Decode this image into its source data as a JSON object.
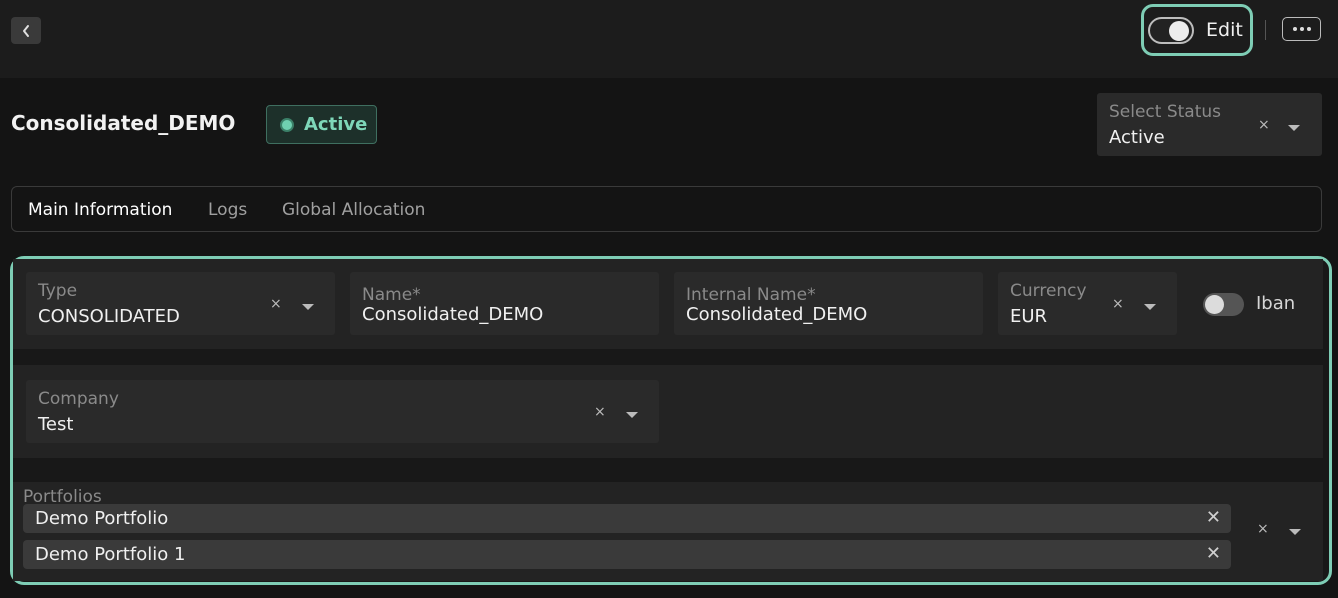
{
  "header": {
    "edit_label": "Edit",
    "edit_enabled": true
  },
  "title": "Consolidated_DEMO",
  "status_badge": "Active",
  "status_select": {
    "label": "Select Status",
    "value": "Active"
  },
  "tabs": [
    {
      "label": "Main Information",
      "active": true
    },
    {
      "label": "Logs",
      "active": false
    },
    {
      "label": "Global Allocation",
      "active": false
    }
  ],
  "form": {
    "type": {
      "label": "Type",
      "value": "CONSOLIDATED"
    },
    "name": {
      "label": "Name*",
      "value": "Consolidated_DEMO"
    },
    "internal_name": {
      "label": "Internal Name*",
      "value": "Consolidated_DEMO"
    },
    "currency": {
      "label": "Currency",
      "value": "EUR"
    },
    "iban": {
      "label": "Iban",
      "enabled": false
    },
    "company": {
      "label": "Company",
      "value": "Test"
    },
    "portfolios": {
      "label": "Portfolios",
      "items": [
        "Demo Portfolio",
        "Demo Portfolio 1"
      ]
    }
  },
  "colors": {
    "accent": "#7ecdb5",
    "active_status": "#7ed7b9",
    "background": "#141414",
    "field_bg": "#2a2a2a"
  },
  "icons": {
    "back": "chevron-left-icon",
    "more": "more-horizontal-icon",
    "clear": "close-icon",
    "dropdown": "caret-down-icon"
  },
  "clear_glyph": "×",
  "chip_remove_glyph": "✕"
}
